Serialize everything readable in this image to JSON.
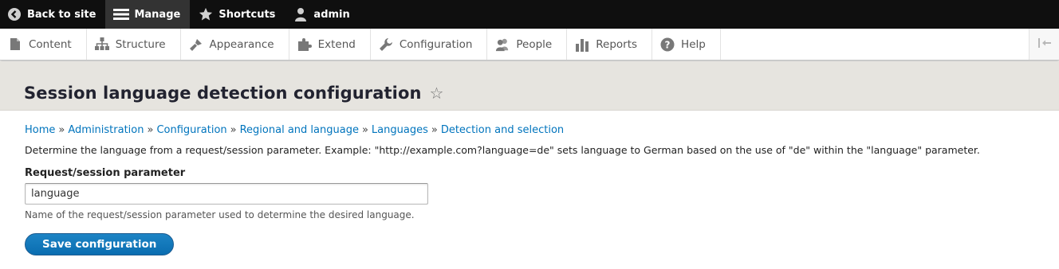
{
  "toolbar": {
    "back_label": "Back to site",
    "manage_label": "Manage",
    "shortcuts_label": "Shortcuts",
    "user_label": "admin"
  },
  "tray": {
    "items": [
      {
        "label": "Content",
        "icon": "file-icon"
      },
      {
        "label": "Structure",
        "icon": "structure-icon"
      },
      {
        "label": "Appearance",
        "icon": "paintbrush-icon"
      },
      {
        "label": "Extend",
        "icon": "puzzle-icon"
      },
      {
        "label": "Configuration",
        "icon": "wrench-icon"
      },
      {
        "label": "People",
        "icon": "people-icon"
      },
      {
        "label": "Reports",
        "icon": "bar-chart-icon"
      },
      {
        "label": "Help",
        "icon": "help-icon"
      }
    ]
  },
  "page": {
    "title": "Session language detection configuration",
    "star": "☆"
  },
  "breadcrumb": {
    "items": [
      "Home",
      "Administration",
      "Configuration",
      "Regional and language",
      "Languages",
      "Detection and selection"
    ],
    "separator": "»"
  },
  "description": "Determine the language from a request/session parameter. Example: \"http://example.com?language=de\" sets language to German based on the use of \"de\" within the \"language\" parameter.",
  "form": {
    "label": "Request/session parameter",
    "value": "language",
    "hint": "Name of the request/session parameter used to determine the desired language.",
    "save_label": "Save configuration"
  },
  "colors": {
    "link": "#0074bd",
    "button": "#0a6db0",
    "header_bg": "#e6e4df"
  }
}
